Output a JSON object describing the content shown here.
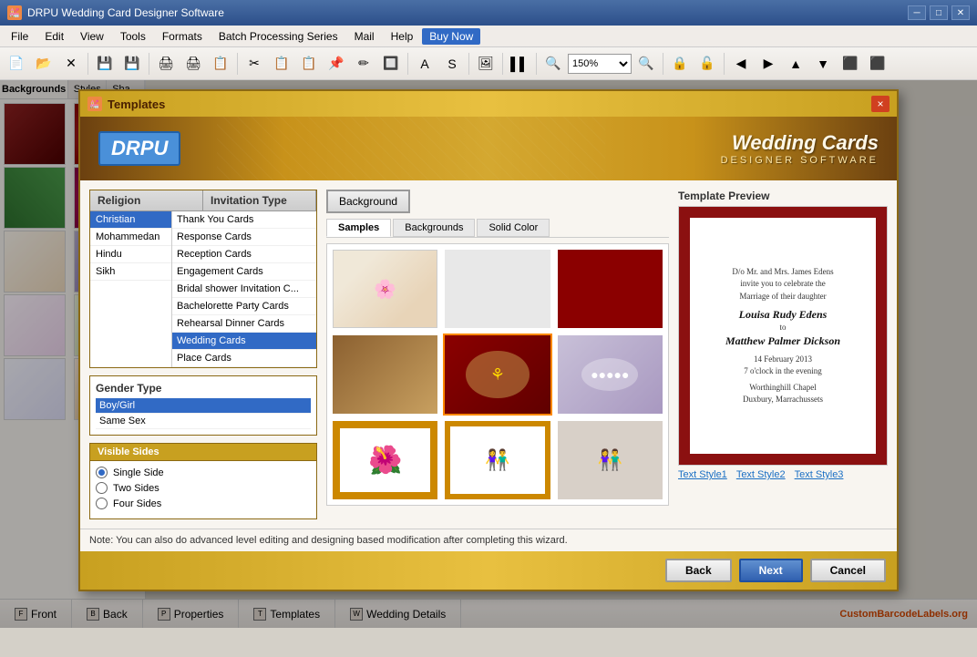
{
  "app": {
    "title": "DRPU Wedding Card Designer Software",
    "icon_label": "D"
  },
  "menu": {
    "items": [
      "File",
      "Edit",
      "View",
      "Tools",
      "Formats",
      "Batch Processing Series",
      "Mail",
      "Help",
      "Buy Now"
    ]
  },
  "toolbar": {
    "zoom": "150%"
  },
  "left_panel": {
    "tabs": [
      "Backgrounds",
      "Styles",
      "Sha..."
    ],
    "backgrounds": [
      "bg1",
      "bg2",
      "bg3",
      "bg4",
      "bg5",
      "bg6",
      "bg7",
      "bg8",
      "bg9",
      "bg10"
    ]
  },
  "dialog": {
    "title": "Templates",
    "close_label": "×",
    "banner": {
      "logo": "DRPU",
      "main_title": "Wedding Cards",
      "sub_title": "DESIGNER SOFTWARE"
    },
    "religion": {
      "header_religion": "Religion",
      "header_invitation": "Invitation Type",
      "religions": [
        "Christian",
        "Mohammedan",
        "Hindu",
        "Sikh"
      ],
      "selected_religion": "Christian",
      "invitations": [
        "Thank You Cards",
        "Response Cards",
        "Reception Cards",
        "Engagement Cards",
        "Bridal shower Invitation C...",
        "Bachelorette Party Cards",
        "Rehearsal Dinner Cards",
        "Wedding Cards",
        "Place Cards"
      ],
      "selected_invitation": "Wedding Cards"
    },
    "gender": {
      "label": "Gender Type",
      "options": [
        "Boy/Girl",
        "Same Sex"
      ],
      "selected": "Boy/Girl"
    },
    "visible_sides": {
      "header": "Visible Sides",
      "options": [
        "Single Side",
        "Two Sides",
        "Four Sides"
      ],
      "selected": "Single Side"
    },
    "background_tab": "Background",
    "template_tabs": [
      "Samples",
      "Backgrounds",
      "Solid Color"
    ],
    "selected_template_tab": "Samples",
    "preview": {
      "label": "Template Preview",
      "text_lines": [
        "D/o Mr. and Mrs. James Edens",
        "invite you to celebrate the",
        "Marriage of their daughter",
        "",
        "Louisa Rudy Edens",
        "to",
        "Matthew Palmer Dickson",
        "",
        "14 February 2013",
        "7 o'clock in the evening",
        "",
        "Worthinghill Chapel",
        "Duxbury, Marrachussets"
      ]
    },
    "text_styles": [
      "Text Style1",
      "Text Style2",
      "Text Style3"
    ],
    "note": "Note: You can also do advanced level editing and designing based modification after completing this wizard.",
    "buttons": {
      "back": "Back",
      "next": "Next",
      "cancel": "Cancel"
    }
  },
  "status_bar": {
    "tabs": [
      "Front",
      "Back",
      "Properties",
      "Templates",
      "Wedding Details"
    ],
    "brand": "CustomBarcodeLabels.org"
  }
}
